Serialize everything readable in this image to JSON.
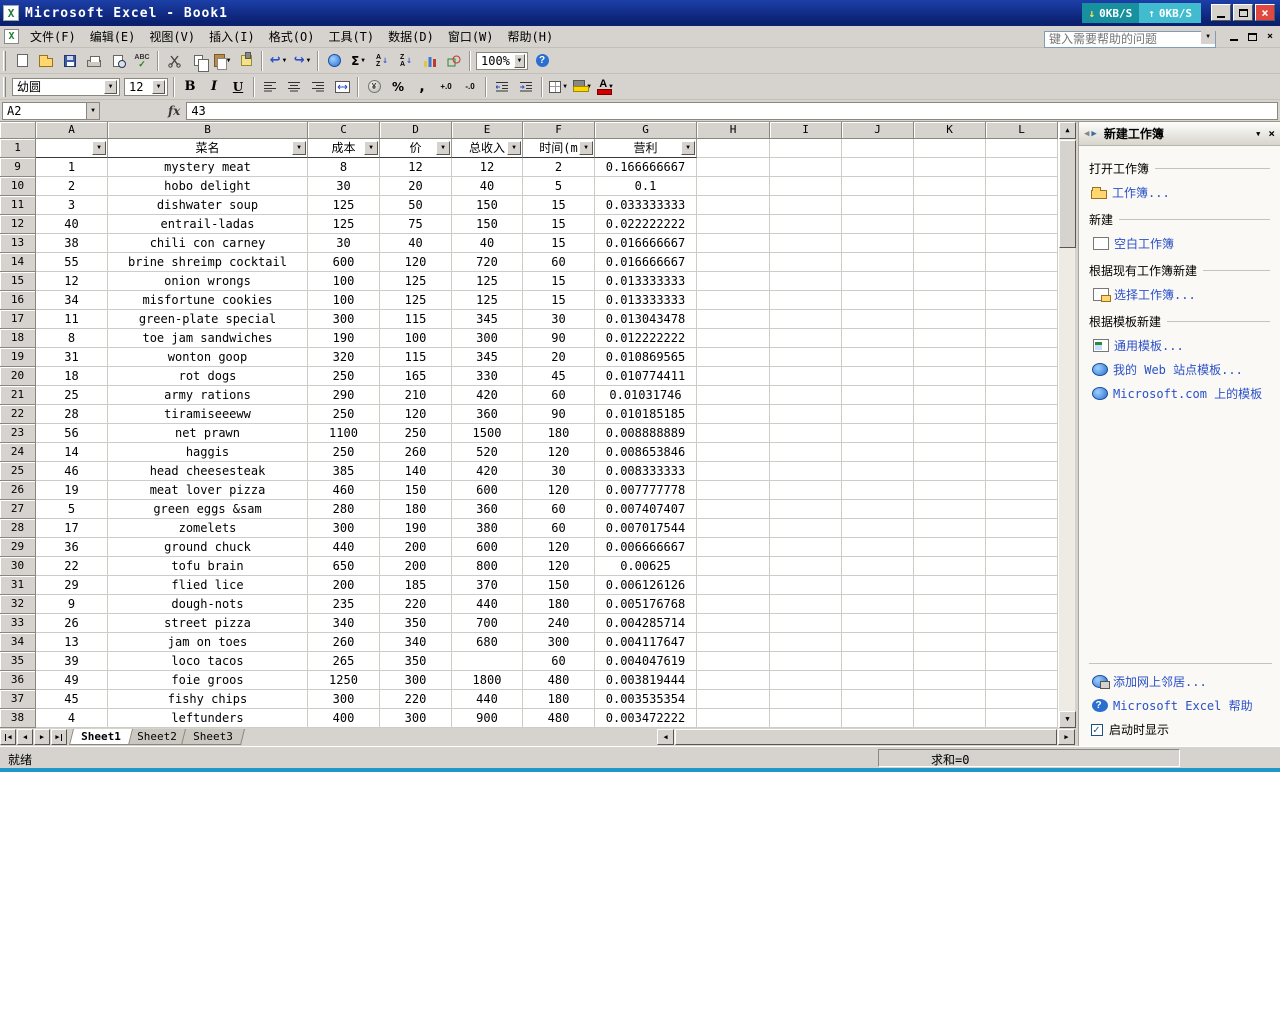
{
  "window": {
    "title": "Microsoft Excel - Book1"
  },
  "net_monitor": {
    "down_label": "0KB/S",
    "up_label": "0KB/S"
  },
  "menu": {
    "items": [
      "文件(F)",
      "编辑(E)",
      "视图(V)",
      "插入(I)",
      "格式(O)",
      "工具(T)",
      "数据(D)",
      "窗口(W)",
      "帮助(H)"
    ],
    "help_placeholder": "键入需要帮助的问题"
  },
  "standard_toolbar": {
    "spell": "ABC",
    "autosum": "Σ",
    "sort_a": "A",
    "sort_z": "Z",
    "zoom": "100%",
    "help": "?"
  },
  "formatting_toolbar": {
    "font_name": "幼圆",
    "font_size": "12",
    "bold": "B",
    "italic": "I",
    "underline": "U",
    "currency": "¥",
    "percent": "%",
    "comma": ",",
    "increase_decimal": "+.0",
    "decrease_decimal": "-.0"
  },
  "formula_bar": {
    "name_box": "A2",
    "fx_label": "fx",
    "content": "43"
  },
  "grid": {
    "column_letters": [
      "A",
      "B",
      "C",
      "D",
      "E",
      "F",
      "G",
      "H",
      "I",
      "J",
      "K",
      "L"
    ],
    "filter_row_number": "1",
    "filter_headers": [
      "",
      "菜名",
      "成本",
      "价",
      "总收入",
      "时间(m",
      "营利"
    ],
    "rows": [
      {
        "n": "9",
        "cells": [
          "1",
          "mystery meat",
          "8",
          "12",
          "12",
          "2",
          "0.166666667"
        ]
      },
      {
        "n": "10",
        "cells": [
          "2",
          "hobo delight",
          "30",
          "20",
          "40",
          "5",
          "0.1"
        ]
      },
      {
        "n": "11",
        "cells": [
          "3",
          "dishwater soup",
          "125",
          "50",
          "150",
          "15",
          "0.033333333"
        ]
      },
      {
        "n": "12",
        "cells": [
          "40",
          "entrail-ladas",
          "125",
          "75",
          "150",
          "15",
          "0.022222222"
        ]
      },
      {
        "n": "13",
        "cells": [
          "38",
          "chili con carney",
          "30",
          "40",
          "40",
          "15",
          "0.016666667"
        ]
      },
      {
        "n": "14",
        "cells": [
          "55",
          "brine shreimp cocktail",
          "600",
          "120",
          "720",
          "60",
          "0.016666667"
        ]
      },
      {
        "n": "15",
        "cells": [
          "12",
          "onion wrongs",
          "100",
          "125",
          "125",
          "15",
          "0.013333333"
        ]
      },
      {
        "n": "16",
        "cells": [
          "34",
          "misfortune cookies",
          "100",
          "125",
          "125",
          "15",
          "0.013333333"
        ]
      },
      {
        "n": "17",
        "cells": [
          "11",
          "green-plate special",
          "300",
          "115",
          "345",
          "30",
          "0.013043478"
        ]
      },
      {
        "n": "18",
        "cells": [
          "8",
          "toe jam sandwiches",
          "190",
          "100",
          "300",
          "90",
          "0.012222222"
        ]
      },
      {
        "n": "19",
        "cells": [
          "31",
          "wonton goop",
          "320",
          "115",
          "345",
          "20",
          "0.010869565"
        ]
      },
      {
        "n": "20",
        "cells": [
          "18",
          "rot dogs",
          "250",
          "165",
          "330",
          "45",
          "0.010774411"
        ]
      },
      {
        "n": "21",
        "cells": [
          "25",
          "army rations",
          "290",
          "210",
          "420",
          "60",
          "0.01031746"
        ]
      },
      {
        "n": "22",
        "cells": [
          "28",
          "tiramiseeeww",
          "250",
          "120",
          "360",
          "90",
          "0.010185185"
        ]
      },
      {
        "n": "23",
        "cells": [
          "56",
          "net prawn",
          "1100",
          "250",
          "1500",
          "180",
          "0.008888889"
        ]
      },
      {
        "n": "24",
        "cells": [
          "14",
          "haggis",
          "250",
          "260",
          "520",
          "120",
          "0.008653846"
        ]
      },
      {
        "n": "25",
        "cells": [
          "46",
          "head cheesesteak",
          "385",
          "140",
          "420",
          "30",
          "0.008333333"
        ]
      },
      {
        "n": "26",
        "cells": [
          "19",
          "meat lover pizza",
          "460",
          "150",
          "600",
          "120",
          "0.007777778"
        ]
      },
      {
        "n": "27",
        "cells": [
          "5",
          "green eggs &sam",
          "280",
          "180",
          "360",
          "60",
          "0.007407407"
        ]
      },
      {
        "n": "28",
        "cells": [
          "17",
          "zomelets",
          "300",
          "190",
          "380",
          "60",
          "0.007017544"
        ]
      },
      {
        "n": "29",
        "cells": [
          "36",
          "ground chuck",
          "440",
          "200",
          "600",
          "120",
          "0.006666667"
        ]
      },
      {
        "n": "30",
        "cells": [
          "22",
          "tofu brain",
          "650",
          "200",
          "800",
          "120",
          "0.00625"
        ]
      },
      {
        "n": "31",
        "cells": [
          "29",
          "flied lice",
          "200",
          "185",
          "370",
          "150",
          "0.006126126"
        ]
      },
      {
        "n": "32",
        "cells": [
          "9",
          "dough-nots",
          "235",
          "220",
          "440",
          "180",
          "0.005176768"
        ]
      },
      {
        "n": "33",
        "cells": [
          "26",
          "street pizza",
          "340",
          "350",
          "700",
          "240",
          "0.004285714"
        ]
      },
      {
        "n": "34",
        "cells": [
          "13",
          "jam on toes",
          "260",
          "340",
          "680",
          "300",
          "0.004117647"
        ]
      },
      {
        "n": "35",
        "cells": [
          "39",
          "loco tacos",
          "265",
          "350",
          "",
          "60",
          "0.004047619"
        ]
      },
      {
        "n": "36",
        "cells": [
          "49",
          "foie groos",
          "1250",
          "300",
          "1800",
          "480",
          "0.003819444"
        ]
      },
      {
        "n": "37",
        "cells": [
          "45",
          "fishy chips",
          "300",
          "220",
          "440",
          "180",
          "0.003535354"
        ]
      },
      {
        "n": "38",
        "cells": [
          "4",
          "leftunders",
          "400",
          "300",
          "900",
          "480",
          "0.003472222"
        ]
      }
    ]
  },
  "sheet_bar": {
    "tabs": [
      "Sheet1",
      "Sheet2",
      "Sheet3"
    ],
    "active_tab": "Sheet1"
  },
  "status_bar": {
    "ready": "就绪",
    "sum": "求和=0"
  },
  "task_pane": {
    "title": "新建工作簿",
    "sections": [
      {
        "header": "打开工作簿",
        "links": [
          {
            "icon": "open-workbook-icon",
            "label": "工作簿..."
          }
        ]
      },
      {
        "header": "新建",
        "links": [
          {
            "icon": "blank-workbook-icon",
            "label": "空白工作簿"
          }
        ]
      },
      {
        "header": "根据现有工作簿新建",
        "links": [
          {
            "icon": "choose-workbook-icon",
            "label": "选择工作簿..."
          }
        ]
      },
      {
        "header": "根据模板新建",
        "links": [
          {
            "icon": "general-templates-icon",
            "label": "通用模板..."
          },
          {
            "icon": "web-templates-icon",
            "label": "我的 Web 站点模板..."
          },
          {
            "icon": "mscom-templates-icon",
            "label": "Microsoft.com 上的模板"
          }
        ]
      }
    ],
    "footer_links": [
      {
        "icon": "network-place-icon",
        "label": "添加网上邻居..."
      },
      {
        "icon": "help-icon",
        "label": "Microsoft Excel 帮助"
      }
    ],
    "startup_checkbox": "启动时显示"
  }
}
